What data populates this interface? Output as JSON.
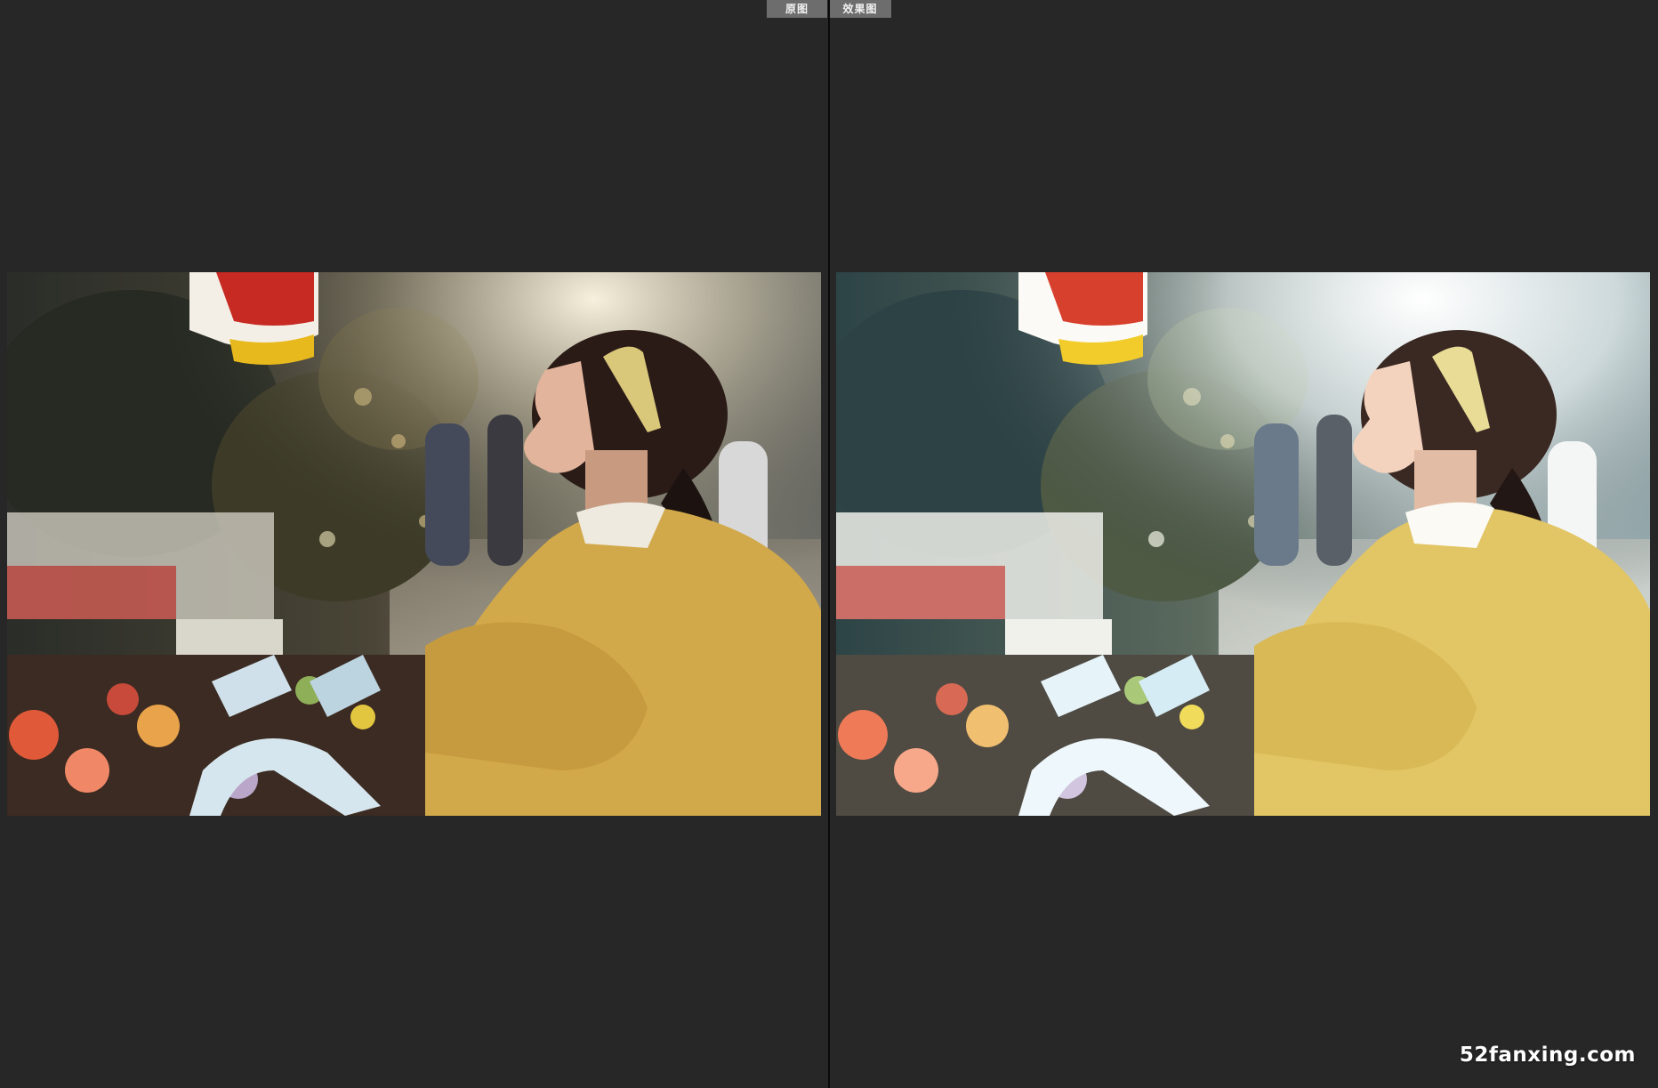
{
  "tabs": {
    "before_label": "原图",
    "after_label": "效果图"
  },
  "icons": {
    "before_image": "photo-portrait-original",
    "after_image": "photo-portrait-edited"
  },
  "colors": {
    "background": "#272727",
    "tab_background": "#6d6d6d",
    "divider": "#0a0a0a",
    "sweater": "#d2a94a",
    "sweater_edited": "#e2c564"
  },
  "watermark": {
    "text": "52fanxing.com"
  }
}
